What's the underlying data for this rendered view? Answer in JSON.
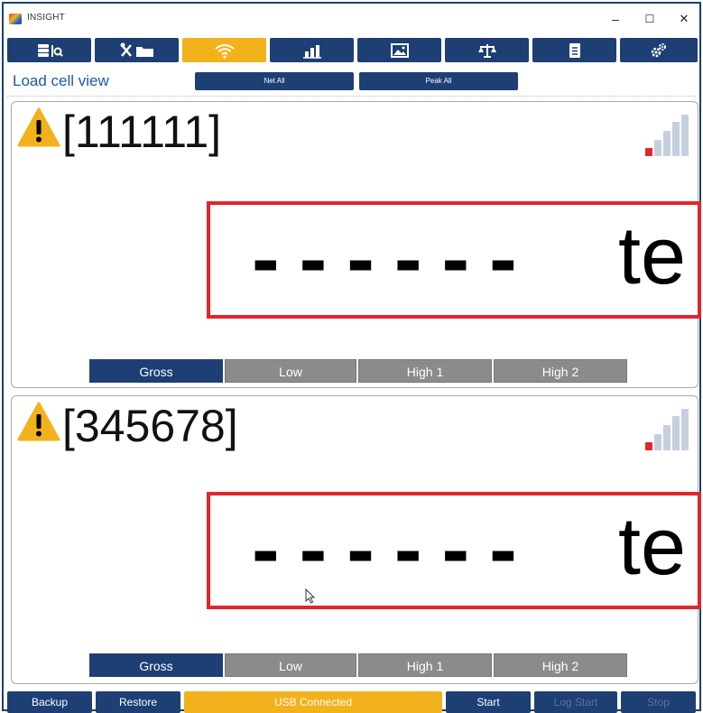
{
  "window": {
    "title": "INSIGHT",
    "controls": {
      "minimize": "–",
      "maximize": "☐",
      "close": "✕"
    }
  },
  "toolbar": {
    "buttons": [
      {
        "icon": "database-search-icon",
        "active": false
      },
      {
        "icon": "tools-folder-icon",
        "active": false
      },
      {
        "icon": "wifi-icon",
        "active": true
      },
      {
        "icon": "chart-icon",
        "active": false
      },
      {
        "icon": "image-icon",
        "active": false
      },
      {
        "icon": "scale-icon",
        "active": false
      },
      {
        "icon": "document-icon",
        "active": false
      },
      {
        "icon": "settings-gears-icon",
        "active": false
      }
    ]
  },
  "subheader": {
    "title": "Load cell view",
    "net_all": "Net All",
    "peak_all": "Peak All"
  },
  "load_cells": [
    {
      "id": "[111111]",
      "reading": "------",
      "unit": "te",
      "modes": [
        "Gross",
        "Low",
        "High 1",
        "High 2"
      ],
      "selected_mode": "Gross"
    },
    {
      "id": "[345678]",
      "reading": "------",
      "unit": "te",
      "modes": [
        "Gross",
        "Low",
        "High 1",
        "High 2"
      ],
      "selected_mode": "Gross"
    }
  ],
  "statusbar": {
    "backup": "Backup",
    "restore": "Restore",
    "usb_status": "USB Connected",
    "start": "Start",
    "log_start": "Log Start",
    "stop": "Stop"
  },
  "colors": {
    "navy": "#1d3f73",
    "accent_yellow": "#f2b21c",
    "alert_red": "#e0262b",
    "mode_grey": "#8b8b8b"
  }
}
